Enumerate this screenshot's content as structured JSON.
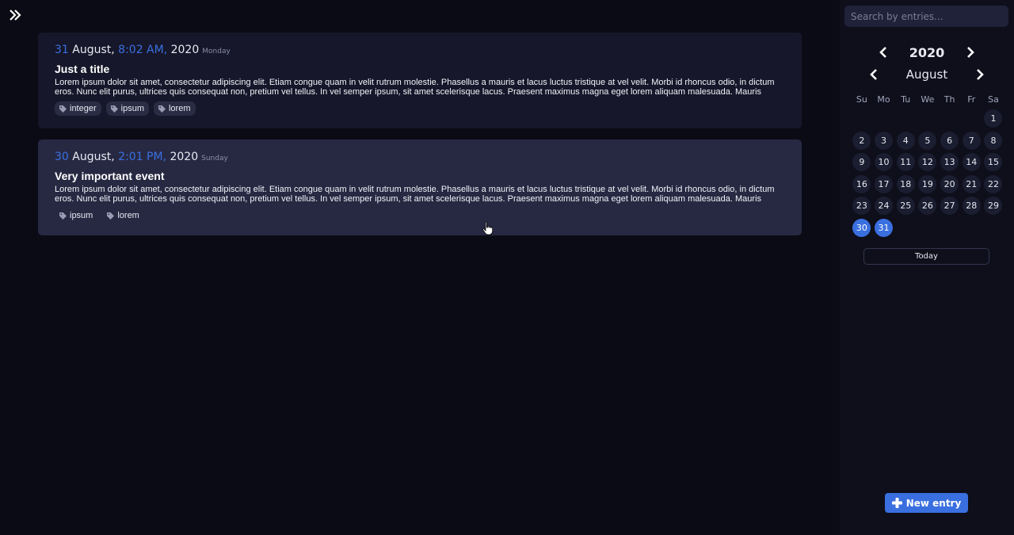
{
  "icons": {
    "toggle": "double-chevron-right",
    "tag": "tag",
    "prev": "chevron-left",
    "next": "chevron-right",
    "plus": "plus"
  },
  "colors": {
    "accent": "#3a6fe0",
    "card": "#16172a",
    "card_hover": "#272943",
    "background": "#0a0b14",
    "sidebar": "#0e0f1b"
  },
  "entries": [
    {
      "day": "31",
      "month": " August, ",
      "time": "8:02 AM,",
      "year": " 2020",
      "weekday": "Monday",
      "title": "Just a title",
      "body": "Lorem ipsum dolor sit amet, consectetur adipiscing elit. Etiam congue quam in velit rutrum molestie. Phasellus a mauris et lacus luctus tristique at vel velit. Morbi id rhoncus odio, in dictum eros. Nunc elit purus, ultrices quis consequat non, pretium vel tellus. In vel semper ipsum, sit amet scelerisque lacus. Praesent maximus magna eget lorem aliquam malesuada. Mauris",
      "tags": [
        "integer",
        "ipsum",
        "lorem"
      ]
    },
    {
      "day": "30",
      "month": " August, ",
      "time": "2:01 PM,",
      "year": " 2020",
      "weekday": "Sunday",
      "title": "Very important event",
      "body": "Lorem ipsum dolor sit amet, consectetur adipiscing elit. Etiam congue quam in velit rutrum molestie. Phasellus a mauris et lacus luctus tristique at vel velit. Morbi id rhoncus odio, in dictum eros. Nunc elit purus, ultrices quis consequat non, pretium vel tellus. In vel semper ipsum, sit amet scelerisque lacus. Praesent maximus magna eget lorem aliquam malesuada. Mauris",
      "tags": [
        "ipsum",
        "lorem"
      ]
    }
  ],
  "sidebar": {
    "search_placeholder": "Search by entries...",
    "year": "2020",
    "month": "August",
    "weekdays": [
      "Su",
      "Mo",
      "Tu",
      "We",
      "Th",
      "Fr",
      "Sa"
    ],
    "first_weekday_index": 6,
    "days": [
      "1",
      "2",
      "3",
      "4",
      "5",
      "6",
      "7",
      "8",
      "9",
      "10",
      "11",
      "12",
      "13",
      "14",
      "15",
      "16",
      "17",
      "18",
      "19",
      "20",
      "21",
      "22",
      "23",
      "24",
      "25",
      "26",
      "27",
      "28",
      "29",
      "30",
      "31"
    ],
    "selected_days": [
      "30",
      "31"
    ],
    "today_label": "Today",
    "new_entry_label": "New entry"
  }
}
